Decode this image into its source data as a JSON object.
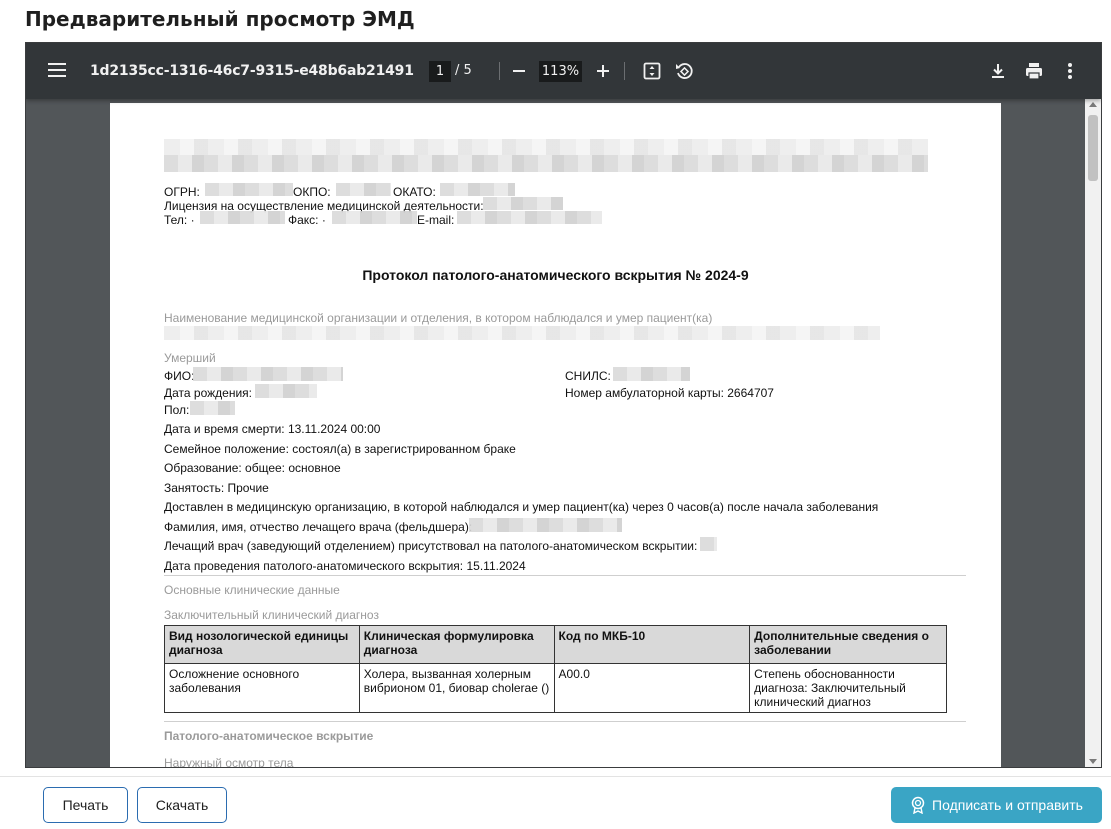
{
  "page_title": "Предварительный просмотр ЭМД",
  "viewer": {
    "filename": "1d2135cc-1316-46c7-9315-e48b6ab21491",
    "current_page": "1",
    "page_separator": "/ 5",
    "zoom": "113%",
    "icons": {
      "menu": "hamburger-menu-icon",
      "zoom_out": "minus-icon",
      "zoom_in": "plus-icon",
      "fit": "fit-page-icon",
      "rotate": "rotate-icon",
      "download": "download-icon",
      "print": "print-icon",
      "more": "more-vertical-icon"
    },
    "colors": {
      "toolbar": "#323639",
      "background": "#525659"
    }
  },
  "document": {
    "header": {
      "ogrn_label": "ОГРН:",
      "okpo_label": "ОКПО:",
      "okato_label": "ОКАТО:",
      "license_label": "Лицензия на осуществление медицинской деятельности:",
      "tel_label": "Тел: ·",
      "fax_label": "Факс: ·",
      "email_label": "E-mail:"
    },
    "title": "Протокол патолого-анатомического вскрытия № 2024-9",
    "org_section_label": "Наименование медицинской организации и отделения, в котором наблюдался и умер пациент(ка)",
    "deceased_section_label": "Умерший",
    "fio_label": "ФИО:",
    "snils_label": "СНИЛС:",
    "birth_label": "Дата рождения:",
    "card_label": "Номер амбулаторной карты: 2664707",
    "sex_label": "Пол:",
    "death_date": "Дата и время смерти: 13.11.2024 00:00",
    "marital": "Семейное положение: состоял(а) в зарегистрированном браке",
    "education": "Образование: общее: основное",
    "employment": "Занятость: Прочие",
    "delivered": "Доставлен в медицинскую организацию, в которой наблюдался и умер пациент(ка) через 0 часов(а) после начала заболевания",
    "doctor_label": "Фамилия, имя, отчество лечащего врача (фельдшера):",
    "doctor_present_label": "Лечащий врач (заведующий отделением) присутствовал на патолого-анатомическом вскрытии:",
    "autopsy_date": "Дата проведения патолого-анатомического вскрытия: 15.11.2024",
    "clinical_section_label": "Основные клинические данные",
    "final_diagnosis_label": "Заключительный клинический диагноз",
    "diagnosis_table": {
      "headers": [
        "Вид нозологической единицы диагноза",
        "Клиническая формулировка диагноза",
        "Код по МКБ-10",
        "Дополнительные сведения о заболевании"
      ],
      "rows": [
        [
          "Осложнение основного заболевания",
          "Холера, вызванная холерным вибрионом 01, биовар cholerae ()",
          "A00.0",
          "Степень обоснованности диагноза: Заключительный клинический диагноз"
        ]
      ]
    },
    "autopsy_section_label": "Патолого-анатомическое вскрытие",
    "external_exam_label": "Наружный осмотр тела"
  },
  "footer": {
    "print_label": "Печать",
    "download_label": "Скачать",
    "sign_label": "Подписать и отправить",
    "sign_icon": "certificate-badge-icon",
    "accent": "#3aa5c5"
  }
}
